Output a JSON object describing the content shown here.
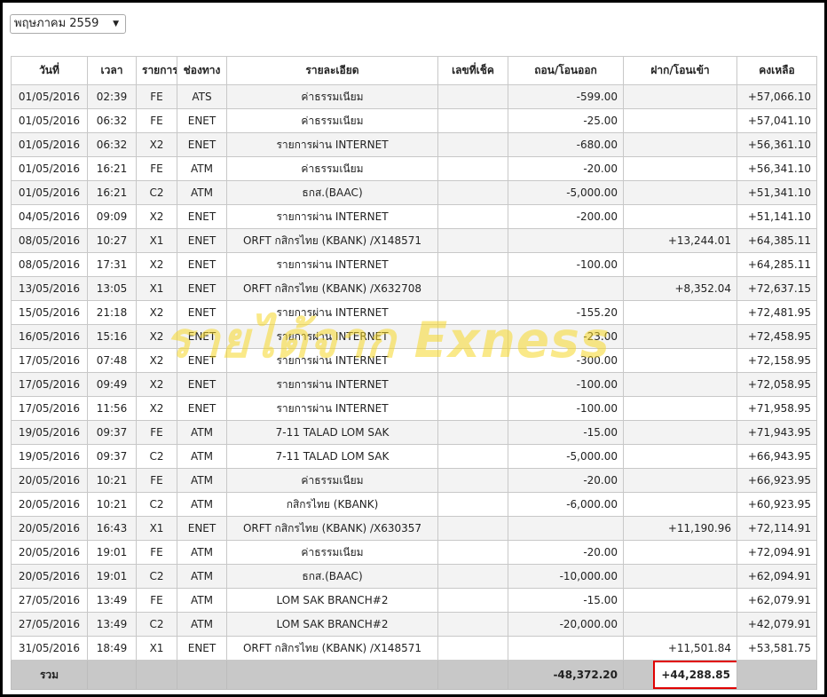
{
  "month_selector": {
    "value": "พฤษภาคม 2559"
  },
  "columns": [
    "วันที่",
    "เวลา",
    "รายการ",
    "ช่องทาง",
    "รายละเอียด",
    "เลขที่เช็ค",
    "ถอน/โอนออก",
    "ฝาก/โอนเข้า",
    "คงเหลือ"
  ],
  "rows": [
    {
      "date": "01/05/2016",
      "time": "02:39",
      "code": "FE",
      "channel": "ATS",
      "detail": "ค่าธรรมเนียม",
      "cheque": "",
      "withdraw": "-599.00",
      "deposit": "",
      "balance": "+57,066.10"
    },
    {
      "date": "01/05/2016",
      "time": "06:32",
      "code": "FE",
      "channel": "ENET",
      "detail": "ค่าธรรมเนียม",
      "cheque": "",
      "withdraw": "-25.00",
      "deposit": "",
      "balance": "+57,041.10"
    },
    {
      "date": "01/05/2016",
      "time": "06:32",
      "code": "X2",
      "channel": "ENET",
      "detail": "รายการผ่าน INTERNET",
      "cheque": "",
      "withdraw": "-680.00",
      "deposit": "",
      "balance": "+56,361.10"
    },
    {
      "date": "01/05/2016",
      "time": "16:21",
      "code": "FE",
      "channel": "ATM",
      "detail": "ค่าธรรมเนียม",
      "cheque": "",
      "withdraw": "-20.00",
      "deposit": "",
      "balance": "+56,341.10"
    },
    {
      "date": "01/05/2016",
      "time": "16:21",
      "code": "C2",
      "channel": "ATM",
      "detail": "ธกส.(BAAC)",
      "cheque": "",
      "withdraw": "-5,000.00",
      "deposit": "",
      "balance": "+51,341.10"
    },
    {
      "date": "04/05/2016",
      "time": "09:09",
      "code": "X2",
      "channel": "ENET",
      "detail": "รายการผ่าน INTERNET",
      "cheque": "",
      "withdraw": "-200.00",
      "deposit": "",
      "balance": "+51,141.10"
    },
    {
      "date": "08/05/2016",
      "time": "10:27",
      "code": "X1",
      "channel": "ENET",
      "detail": "ORFT กสิกรไทย (KBANK) /X148571",
      "cheque": "",
      "withdraw": "",
      "deposit": "+13,244.01",
      "balance": "+64,385.11"
    },
    {
      "date": "08/05/2016",
      "time": "17:31",
      "code": "X2",
      "channel": "ENET",
      "detail": "รายการผ่าน INTERNET",
      "cheque": "",
      "withdraw": "-100.00",
      "deposit": "",
      "balance": "+64,285.11"
    },
    {
      "date": "13/05/2016",
      "time": "13:05",
      "code": "X1",
      "channel": "ENET",
      "detail": "ORFT กสิกรไทย (KBANK) /X632708",
      "cheque": "",
      "withdraw": "",
      "deposit": "+8,352.04",
      "balance": "+72,637.15"
    },
    {
      "date": "15/05/2016",
      "time": "21:18",
      "code": "X2",
      "channel": "ENET",
      "detail": "รายการผ่าน INTERNET",
      "cheque": "",
      "withdraw": "-155.20",
      "deposit": "",
      "balance": "+72,481.95"
    },
    {
      "date": "16/05/2016",
      "time": "15:16",
      "code": "X2",
      "channel": "ENET",
      "detail": "รายการผ่าน INTERNET",
      "cheque": "",
      "withdraw": "-23.00",
      "deposit": "",
      "balance": "+72,458.95"
    },
    {
      "date": "17/05/2016",
      "time": "07:48",
      "code": "X2",
      "channel": "ENET",
      "detail": "รายการผ่าน INTERNET",
      "cheque": "",
      "withdraw": "-300.00",
      "deposit": "",
      "balance": "+72,158.95"
    },
    {
      "date": "17/05/2016",
      "time": "09:49",
      "code": "X2",
      "channel": "ENET",
      "detail": "รายการผ่าน INTERNET",
      "cheque": "",
      "withdraw": "-100.00",
      "deposit": "",
      "balance": "+72,058.95"
    },
    {
      "date": "17/05/2016",
      "time": "11:56",
      "code": "X2",
      "channel": "ENET",
      "detail": "รายการผ่าน INTERNET",
      "cheque": "",
      "withdraw": "-100.00",
      "deposit": "",
      "balance": "+71,958.95"
    },
    {
      "date": "19/05/2016",
      "time": "09:37",
      "code": "FE",
      "channel": "ATM",
      "detail": "7-11 TALAD LOM SAK",
      "cheque": "",
      "withdraw": "-15.00",
      "deposit": "",
      "balance": "+71,943.95"
    },
    {
      "date": "19/05/2016",
      "time": "09:37",
      "code": "C2",
      "channel": "ATM",
      "detail": "7-11 TALAD LOM SAK",
      "cheque": "",
      "withdraw": "-5,000.00",
      "deposit": "",
      "balance": "+66,943.95"
    },
    {
      "date": "20/05/2016",
      "time": "10:21",
      "code": "FE",
      "channel": "ATM",
      "detail": "ค่าธรรมเนียม",
      "cheque": "",
      "withdraw": "-20.00",
      "deposit": "",
      "balance": "+66,923.95"
    },
    {
      "date": "20/05/2016",
      "time": "10:21",
      "code": "C2",
      "channel": "ATM",
      "detail": "กสิกรไทย (KBANK)",
      "cheque": "",
      "withdraw": "-6,000.00",
      "deposit": "",
      "balance": "+60,923.95"
    },
    {
      "date": "20/05/2016",
      "time": "16:43",
      "code": "X1",
      "channel": "ENET",
      "detail": "ORFT กสิกรไทย (KBANK) /X630357",
      "cheque": "",
      "withdraw": "",
      "deposit": "+11,190.96",
      "balance": "+72,114.91"
    },
    {
      "date": "20/05/2016",
      "time": "19:01",
      "code": "FE",
      "channel": "ATM",
      "detail": "ค่าธรรมเนียม",
      "cheque": "",
      "withdraw": "-20.00",
      "deposit": "",
      "balance": "+72,094.91"
    },
    {
      "date": "20/05/2016",
      "time": "19:01",
      "code": "C2",
      "channel": "ATM",
      "detail": "ธกส.(BAAC)",
      "cheque": "",
      "withdraw": "-10,000.00",
      "deposit": "",
      "balance": "+62,094.91"
    },
    {
      "date": "27/05/2016",
      "time": "13:49",
      "code": "FE",
      "channel": "ATM",
      "detail": "LOM SAK BRANCH#2",
      "cheque": "",
      "withdraw": "-15.00",
      "deposit": "",
      "balance": "+62,079.91"
    },
    {
      "date": "27/05/2016",
      "time": "13:49",
      "code": "C2",
      "channel": "ATM",
      "detail": "LOM SAK BRANCH#2",
      "cheque": "",
      "withdraw": "-20,000.00",
      "deposit": "",
      "balance": "+42,079.91"
    },
    {
      "date": "31/05/2016",
      "time": "18:49",
      "code": "X1",
      "channel": "ENET",
      "detail": "ORFT กสิกรไทย (KBANK) /X148571",
      "cheque": "",
      "withdraw": "",
      "deposit": "+11,501.84",
      "balance": "+53,581.75"
    }
  ],
  "total": {
    "label": "รวม",
    "withdraw": "-48,372.20",
    "deposit": "+44,288.85"
  },
  "watermark": "รายได้จาก Exness",
  "colors": {
    "highlight_box": "#e00000",
    "watermark": "#f5d728",
    "total_row": "#c8c8c8"
  }
}
